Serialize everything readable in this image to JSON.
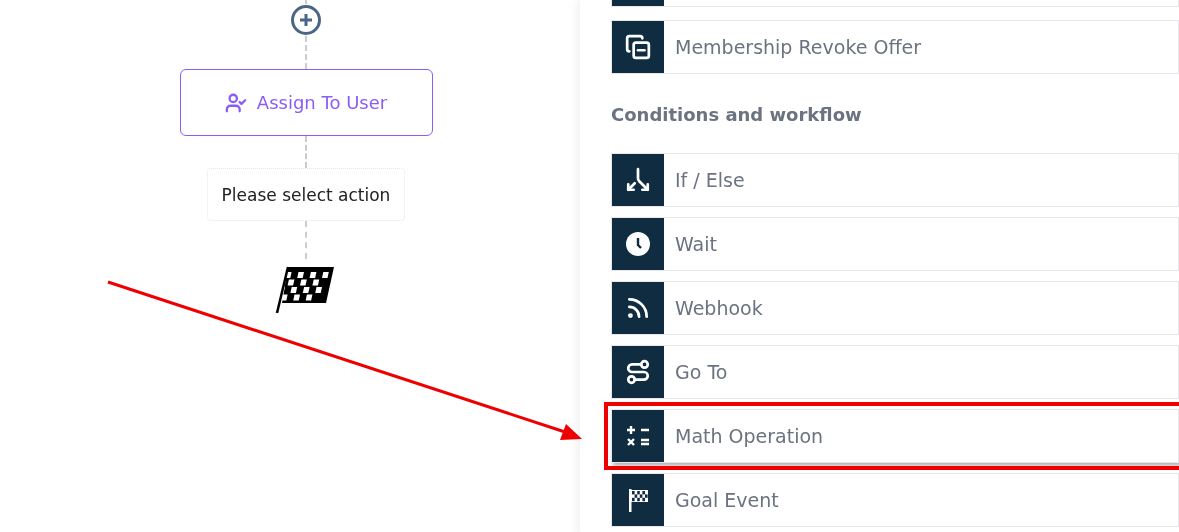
{
  "canvas": {
    "assign_node": {
      "label": "Assign To User"
    },
    "pending_node": {
      "label": "Please select action"
    }
  },
  "panel": {
    "items_before": [
      {
        "kind": "revoke",
        "label": "Membership Revoke Offer",
        "highlighted": false
      }
    ],
    "section_title": "Conditions and workflow",
    "items": [
      {
        "kind": "branch",
        "label": "If / Else",
        "highlighted": false
      },
      {
        "kind": "wait",
        "label": "Wait",
        "highlighted": false
      },
      {
        "kind": "webhook",
        "label": "Webhook",
        "highlighted": false
      },
      {
        "kind": "goto",
        "label": "Go To",
        "highlighted": false
      },
      {
        "kind": "math",
        "label": "Math Operation",
        "highlighted": true
      },
      {
        "kind": "goal",
        "label": "Goal Event",
        "highlighted": false
      }
    ]
  }
}
